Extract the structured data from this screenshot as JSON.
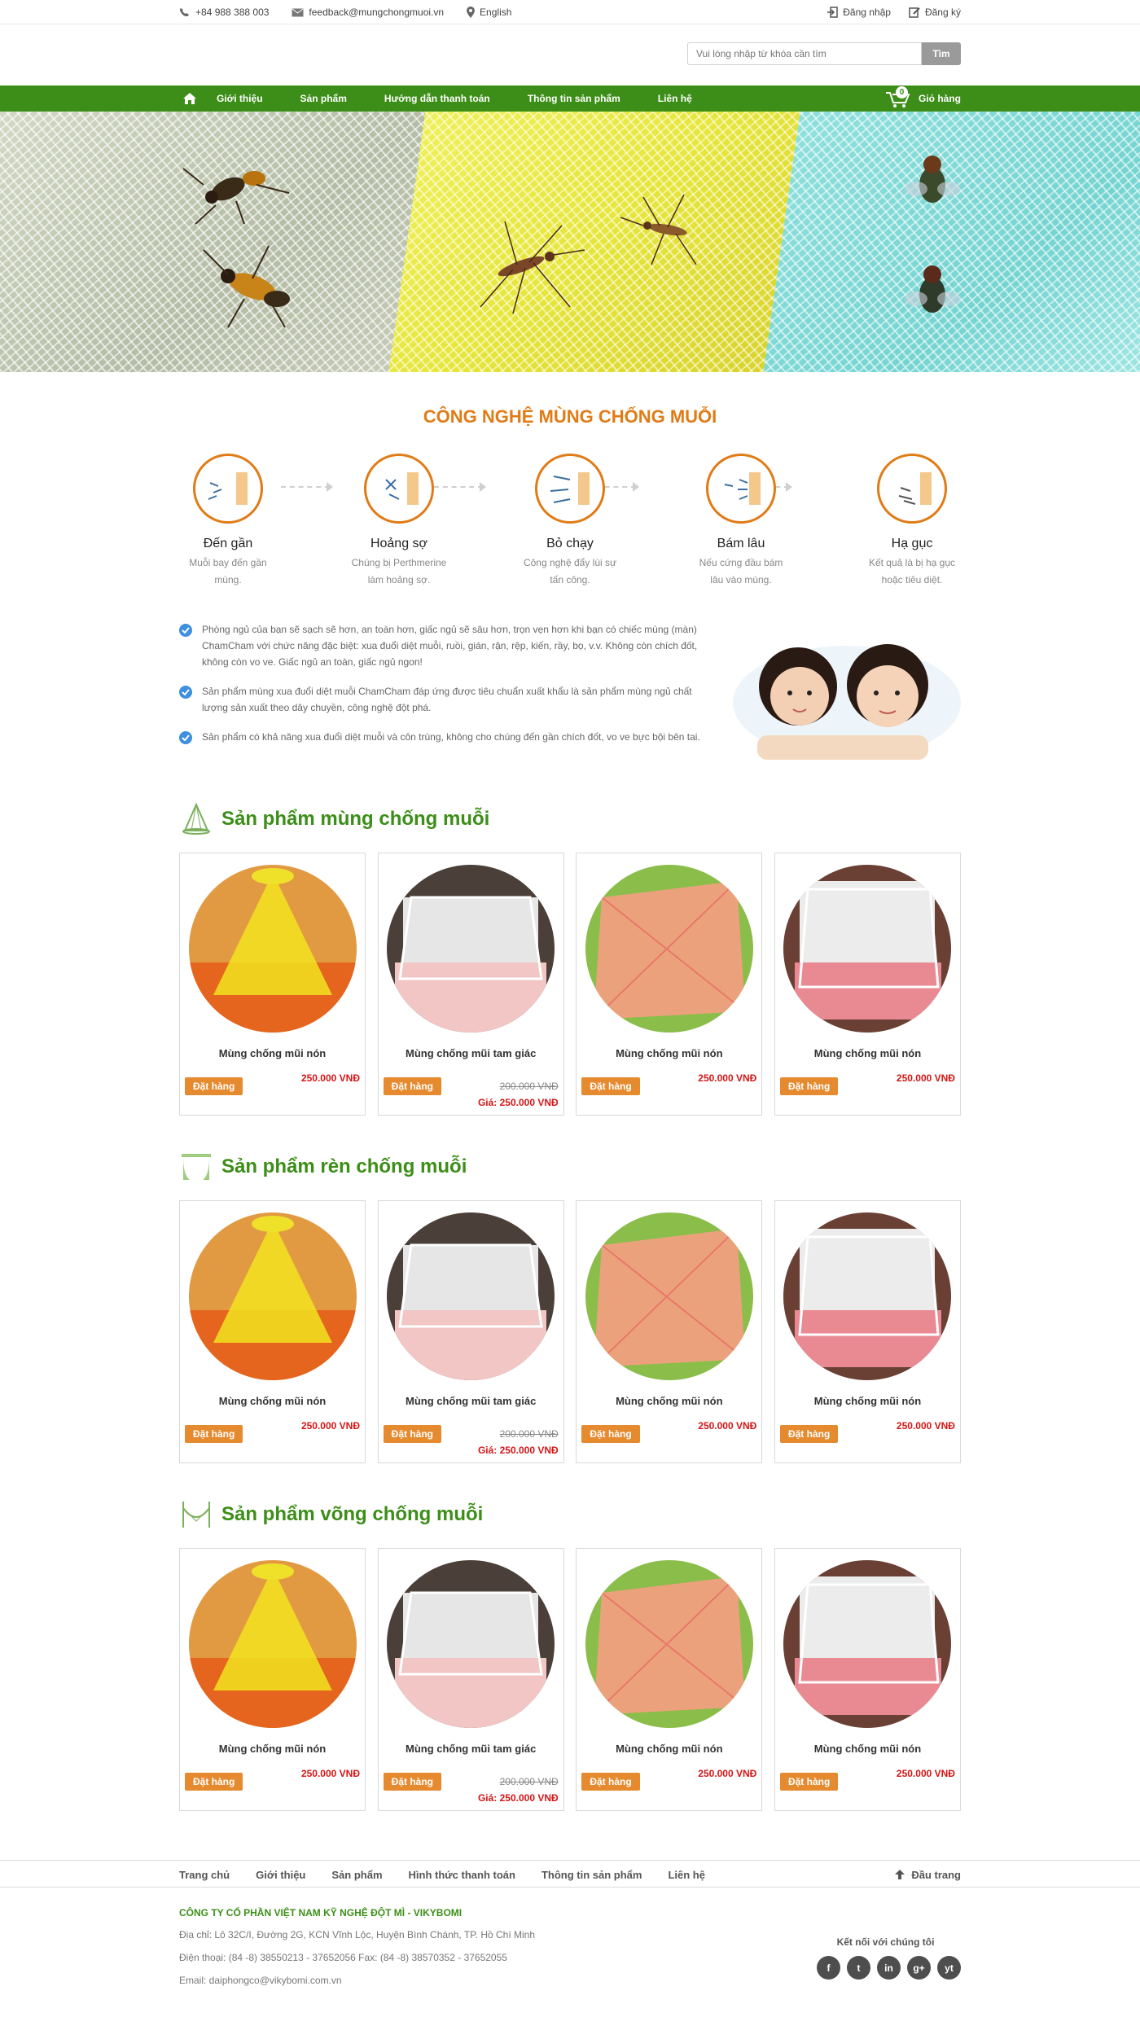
{
  "topbar": {
    "phone": "+84 988 388 003",
    "email": "feedback@mungchongmuoi.vn",
    "language": "English",
    "login": "Đăng nhập",
    "register": "Đăng ký"
  },
  "search": {
    "placeholder": "Vui lòng nhập từ khóa cần tìm",
    "button": "Tìm"
  },
  "nav": {
    "items": [
      "Giới thiệu",
      "Sản phẩm",
      "Hướng dẫn thanh toán",
      "Thông tin sản phẩm",
      "Liên hệ"
    ],
    "cart_label": "Giỏ hàng",
    "cart_count": "0"
  },
  "tech": {
    "title": "CÔNG NGHỆ MÙNG CHỐNG MUỖI",
    "steps": [
      {
        "name": "Đến gần",
        "desc": "Muỗi bay đến gần mùng."
      },
      {
        "name": "Hoảng sợ",
        "desc": "Chúng bị Perthmerine làm hoảng sợ."
      },
      {
        "name": "Bỏ chạy",
        "desc": "Công nghệ đẩy lùi sự tấn công."
      },
      {
        "name": "Bám lâu",
        "desc": "Nếu cứng đầu bám lâu vào mùng."
      },
      {
        "name": "Hạ gục",
        "desc": "Kết quả là bị hạ gục hoặc tiêu diệt."
      }
    ]
  },
  "features": [
    "Phòng ngủ của bạn sẽ sạch sẽ hơn, an toàn hơn, giấc ngủ sẽ sâu hơn, trọn vẹn hơn khi bạn có chiếc mùng (màn) ChamCham với chức năng đặc biệt: xua đuổi diệt muỗi, ruồi, gián, rận, rệp, kiến, rầy, bọ, v.v. Không còn chích đốt, không còn vo ve. Giấc ngủ an toàn, giấc ngủ ngon!",
    "Sản phẩm mùng xua đuổi diệt muỗi ChamCham đáp ứng được tiêu chuẩn xuất khẩu là sản phẩm mùng ngủ chất lượng sản xuất theo dây chuyền, công nghệ đột phá.",
    "Sản phẩm có khả năng xua đuổi diệt muỗi và côn trùng, không cho chúng đến gần chích đốt, vo ve bực bội bên tai."
  ],
  "sections": [
    {
      "title": "Sản phẩm mùng chống muỗi",
      "products": [
        {
          "name": "Mùng chống mũi nón",
          "order": "Đặt hàng",
          "price": "250.000 VNĐ"
        },
        {
          "name": "Mùng chống mũi tam giác",
          "order": "Đặt hàng",
          "old_price": "200.000 VNĐ",
          "sale_price": "Giá: 250.000 VNĐ"
        },
        {
          "name": "Mùng chống mũi nón",
          "order": "Đặt hàng",
          "price": "250.000 VNĐ"
        },
        {
          "name": "Mùng chống mũi nón",
          "order": "Đặt hàng",
          "price": "250.000 VNĐ"
        }
      ]
    },
    {
      "title": "Sản phẩm rèn chống muỗi",
      "products": [
        {
          "name": "Mùng chống mũi nón",
          "order": "Đặt hàng",
          "price": "250.000 VNĐ"
        },
        {
          "name": "Mùng chống mũi tam giác",
          "order": "Đặt hàng",
          "old_price": "200.000 VNĐ",
          "sale_price": "Giá: 250.000 VNĐ"
        },
        {
          "name": "Mùng chống mũi nón",
          "order": "Đặt hàng",
          "price": "250.000 VNĐ"
        },
        {
          "name": "Mùng chống mũi nón",
          "order": "Đặt hàng",
          "price": "250.000 VNĐ"
        }
      ]
    },
    {
      "title": "Sản phẩm võng chống muỗi",
      "products": [
        {
          "name": "Mùng chống mũi nón",
          "order": "Đặt hàng",
          "price": "250.000 VNĐ"
        },
        {
          "name": "Mùng chống mũi tam giác",
          "order": "Đặt hàng",
          "old_price": "200.000 VNĐ",
          "sale_price": "Giá: 250.000 VNĐ"
        },
        {
          "name": "Mùng chống mũi nón",
          "order": "Đặt hàng",
          "price": "250.000 VNĐ"
        },
        {
          "name": "Mùng chống mũi nón",
          "order": "Đặt hàng",
          "price": "250.000 VNĐ"
        }
      ]
    }
  ],
  "footer_nav": {
    "items": [
      "Trang chủ",
      "Giới thiệu",
      "Sản phẩm",
      "Hình thức thanh toán",
      "Thông tin sản phẩm",
      "Liên hệ"
    ],
    "top": "Đầu trang"
  },
  "footer": {
    "company": "CÔNG TY CỔ PHẦN VIỆT NAM KỸ NGHỆ ĐỘT MÌ - VIKYBOMI",
    "address": "Địa chỉ: Lô 32C/I, Đường 2G, KCN Vĩnh Lộc, Huyện Bình Chánh, TP. Hồ Chí Minh",
    "phone": "Điện thoại: (84 -8) 38550213 - 37652056 Fax: (84 -8) 38570352 - 37652055",
    "email": "Email: daiphongco@vikybomi.com.vn",
    "social_title": "Kết nối với chúng tôi",
    "social": [
      "f",
      "t",
      "in",
      "g+",
      "yt"
    ]
  },
  "colors": {
    "brand_green": "#3c8e18",
    "accent_orange": "#e07b16",
    "order_button": "#e58a2f",
    "price_red": "#d41515"
  }
}
